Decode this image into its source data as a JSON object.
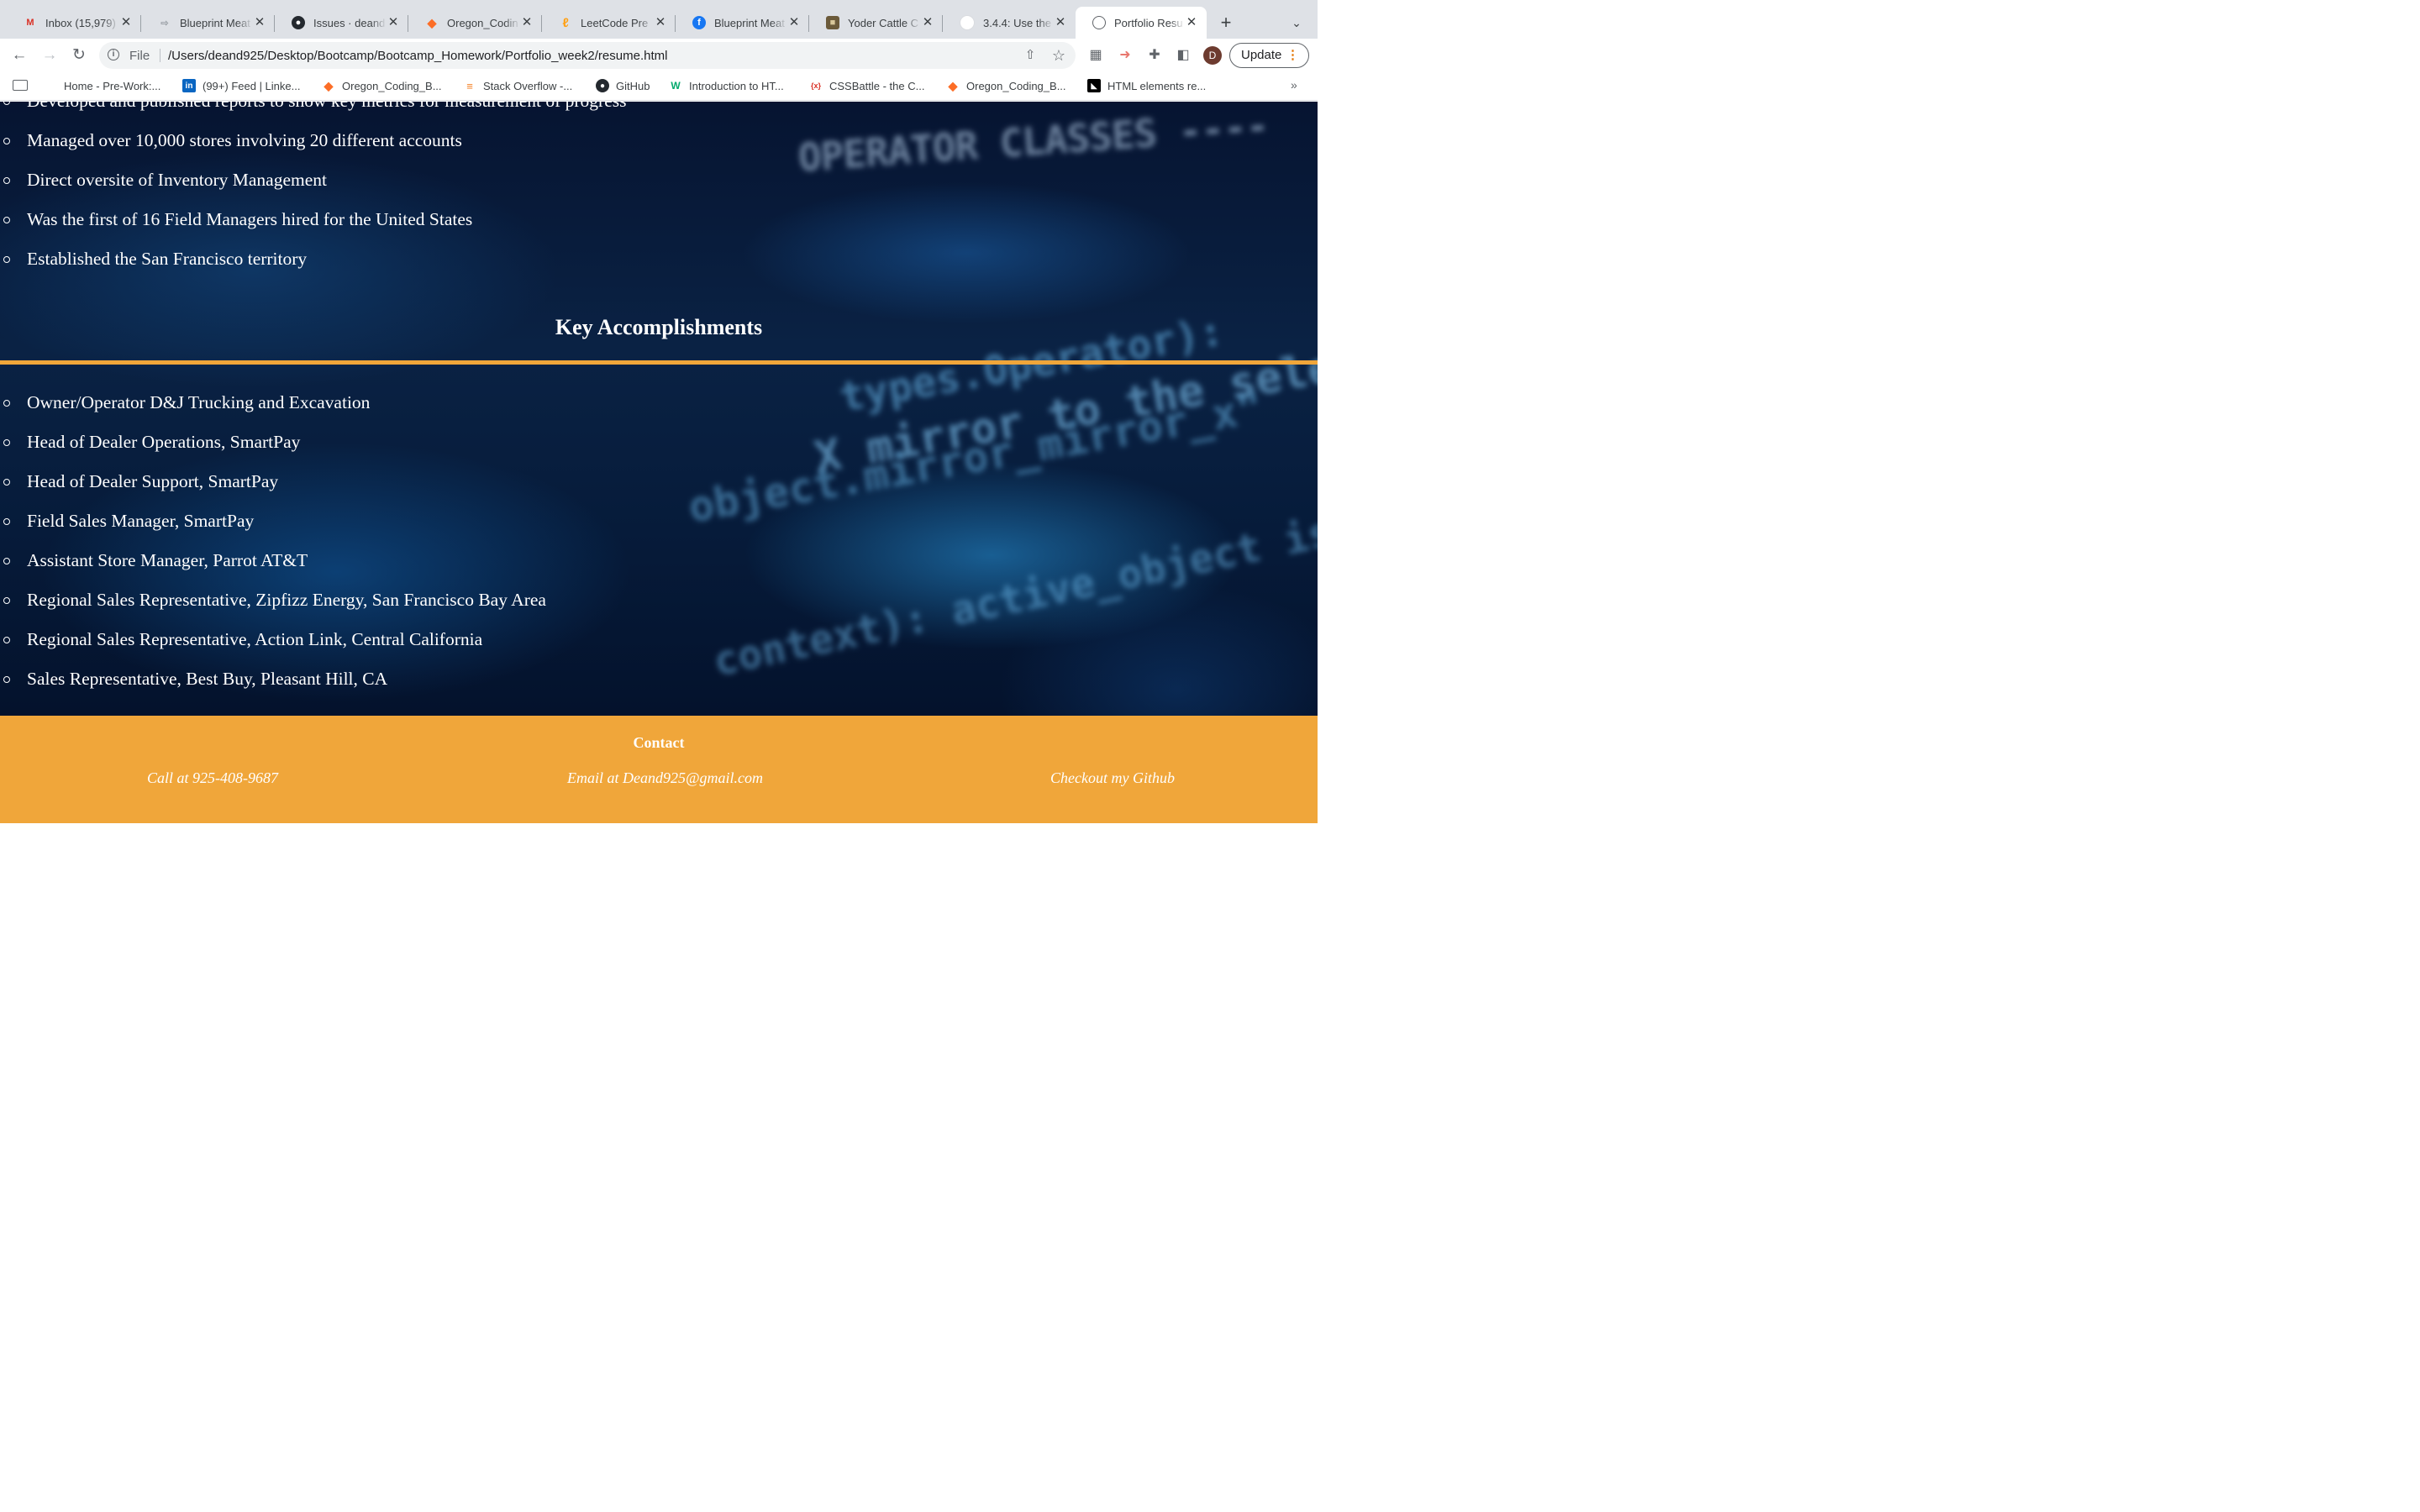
{
  "browser": {
    "tabs": [
      {
        "title": "Inbox (15,979)",
        "icon": "gmail-icon"
      },
      {
        "title": "Blueprint Meat",
        "icon": "blueprint-icon"
      },
      {
        "title": "Issues · deand",
        "icon": "github-icon"
      },
      {
        "title": "Oregon_Codin",
        "icon": "gitlab-icon"
      },
      {
        "title": "LeetCode Pre",
        "icon": "leetcode-icon"
      },
      {
        "title": "Blueprint Meat",
        "icon": "facebook-icon"
      },
      {
        "title": "Yoder Cattle C",
        "icon": "cattle-icon"
      },
      {
        "title": "3.4.4: Use the",
        "icon": "circle-icon"
      },
      {
        "title": "Portfolio Resu",
        "icon": "globe-icon",
        "active": true
      }
    ],
    "address": {
      "scheme_label": "File",
      "url": "/Users/deand925/Desktop/Bootcamp/Bootcamp_Homework/Portfolio_week2/resume.html"
    },
    "profile_initial": "D",
    "update_label": "Update",
    "bookmarks": [
      {
        "label": "Home - Pre-Work:...",
        "icon": "home-icon"
      },
      {
        "label": "(99+) Feed | Linke...",
        "icon": "linkedin-icon"
      },
      {
        "label": "Oregon_Coding_B...",
        "icon": "gitlab-icon"
      },
      {
        "label": "Stack Overflow -...",
        "icon": "stackoverflow-icon"
      },
      {
        "label": "GitHub",
        "icon": "github-icon"
      },
      {
        "label": "Introduction to HT...",
        "icon": "w3-icon"
      },
      {
        "label": "CSSBattle - the C...",
        "icon": "cssbattle-icon"
      },
      {
        "label": "Oregon_Coding_B...",
        "icon": "gitlab-icon"
      },
      {
        "label": "HTML elements re...",
        "icon": "mdn-icon"
      }
    ]
  },
  "page": {
    "experience_items": [
      "Developed and published reports to show key metrics for measurement of progress",
      "Managed over 10,000 stores involving 20 different accounts",
      "Direct oversite of Inventory Management",
      "Was the first of 16 Field Managers hired for the United States",
      "Established the San Francisco territory"
    ],
    "accomplishments_title": "Key Accomplishments",
    "accomplishments": [
      "Owner/Operator D&J Trucking and Excavation",
      "Head of Dealer Operations, SmartPay",
      "Head of Dealer Support, SmartPay",
      "Field Sales Manager, SmartPay",
      "Assistant Store Manager, Parrot AT&T",
      "Regional Sales Representative, Zipfizz Energy, San Francisco Bay Area",
      "Regional Sales Representative, Action Link, Central California",
      "Sales Representative, Best Buy, Pleasant Hill, CA"
    ],
    "background_code": {
      "line1": "OPERATOR CLASSES ----",
      "line2": "types.Operator):",
      "line3": "X mirror to the selected",
      "line4": "object.mirror_mirror_x\"",
      "line5": "context):  active_object is not"
    },
    "footer": {
      "title": "Contact",
      "phone": "Call at 925-408-9687",
      "email": "Email at Deand925@gmail.com",
      "github": "Checkout my Github"
    }
  },
  "colors": {
    "accent": "#f0a63a",
    "hero_dark": "#061431",
    "hero_glow": "#2896dc"
  }
}
